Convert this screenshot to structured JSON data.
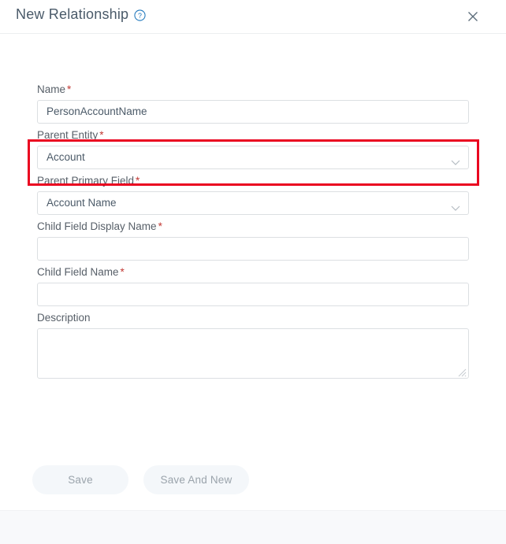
{
  "header": {
    "title": "New Relationship",
    "help_icon": "question-circle-icon",
    "close_icon": "close-icon",
    "help_color": "#1b75bb",
    "title_color": "#4a5a69"
  },
  "form": {
    "required_marker": "*",
    "fields": [
      {
        "label": "Name",
        "required": true,
        "type": "text",
        "value": "PersonAccountName",
        "placeholder": ""
      },
      {
        "label": "Parent Entity",
        "required": true,
        "type": "select",
        "value": "Account",
        "placeholder": ""
      },
      {
        "label": "Parent Primary Field",
        "required": true,
        "type": "select",
        "value": "Account Name",
        "placeholder": "",
        "highlighted": true
      },
      {
        "label": "Child Field Display Name",
        "required": true,
        "type": "text",
        "value": "",
        "placeholder": ""
      },
      {
        "label": "Child Field Name",
        "required": true,
        "type": "text",
        "value": "",
        "placeholder": ""
      },
      {
        "label": "Description",
        "required": false,
        "type": "textarea",
        "value": "",
        "placeholder": ""
      }
    ]
  },
  "highlight": {
    "color": "#ea0520",
    "target": "Parent Primary Field"
  },
  "footer": {
    "save_label": "Save",
    "save_and_new_label": "Save And New",
    "buttons_disabled": true,
    "button_bg": "#f4f7fa",
    "button_text_color": "#9aa3ab"
  }
}
